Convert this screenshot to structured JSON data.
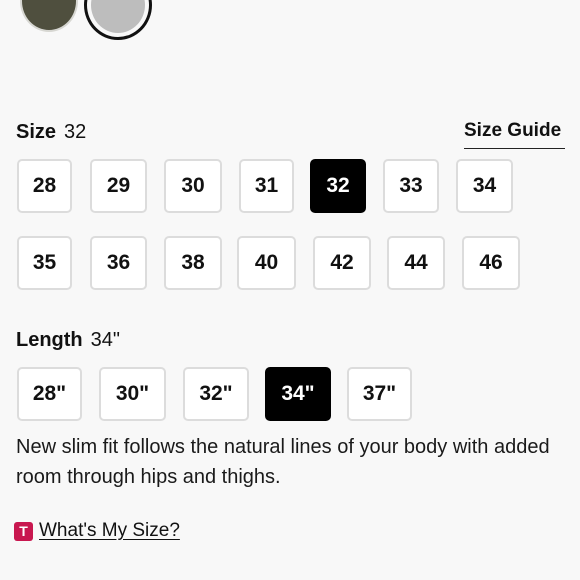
{
  "swatches": [
    {
      "name": "olive",
      "color": "#4f4f3e",
      "selected": false
    },
    {
      "name": "grey",
      "color": "#bdbdbd",
      "selected": true
    }
  ],
  "size": {
    "label": "Size",
    "selected_value": "32",
    "guide_label": "Size Guide",
    "options_row1": [
      "28",
      "29",
      "30",
      "31",
      "32",
      "33",
      "34"
    ],
    "options_row2": [
      "35",
      "36",
      "38",
      "40",
      "42",
      "44",
      "46"
    ]
  },
  "length": {
    "label": "Length",
    "selected_value": "34\"",
    "options": [
      "28\"",
      "30\"",
      "32\"",
      "34\"",
      "37\""
    ]
  },
  "description": "New slim fit follows the natural lines of your body with added room through hips and thighs.",
  "whats_my_size": {
    "icon_letter": "T",
    "label": "What's My Size?",
    "icon_color": "#c8174f"
  },
  "colors": {
    "selected_chip": "#000000",
    "chip_border": "#dcdcdc"
  }
}
